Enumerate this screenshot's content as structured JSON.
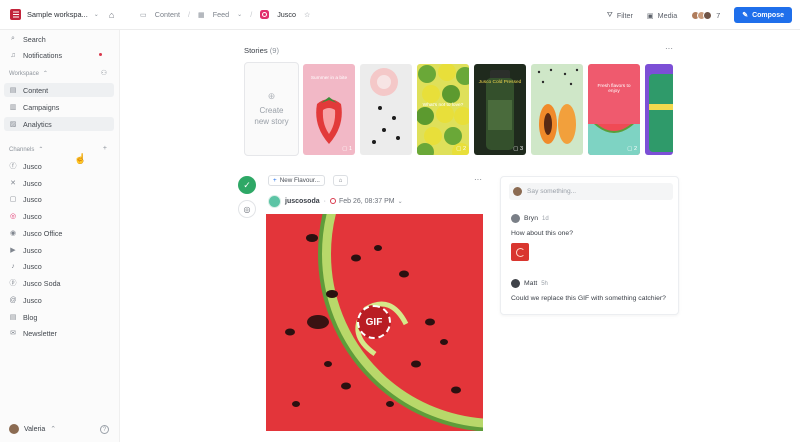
{
  "workspace": {
    "name": "Sample workspa...",
    "logo_color": "#c2243b"
  },
  "breadcrumbs": {
    "content": "Content",
    "feed": "Feed",
    "account": "Jusco"
  },
  "toolbar": {
    "filter": "Filter",
    "media": "Media",
    "collaborators_count": "7",
    "compose": "Compose",
    "accent": "#1f6feb"
  },
  "sidebar": {
    "search": "Search",
    "notifications": "Notifications",
    "workspace_heading": "Workspace",
    "workspace_items": [
      {
        "label": "Content",
        "icon": "content-icon"
      },
      {
        "label": "Campaigns",
        "icon": "campaigns-icon"
      },
      {
        "label": "Analytics",
        "icon": "analytics-icon"
      }
    ],
    "channels_heading": "Channels",
    "channels": [
      {
        "label": "Jusco",
        "icon": "facebook-icon"
      },
      {
        "label": "Jusco",
        "icon": "x-icon"
      },
      {
        "label": "Jusco",
        "icon": "linkedin-icon"
      },
      {
        "label": "Jusco",
        "icon": "instagram-icon"
      },
      {
        "label": "Jusco Office",
        "icon": "google-business-icon"
      },
      {
        "label": "Jusco",
        "icon": "youtube-icon"
      },
      {
        "label": "Jusco",
        "icon": "tiktok-icon"
      },
      {
        "label": "Jusco Soda",
        "icon": "pinterest-icon"
      },
      {
        "label": "Jusco",
        "icon": "threads-icon"
      },
      {
        "label": "Blog",
        "icon": "blog-icon"
      },
      {
        "label": "Newsletter",
        "icon": "newsletter-icon"
      }
    ],
    "user": "Valeria"
  },
  "stories": {
    "title": "Stories",
    "count": "(9)",
    "create_label_1": "Create",
    "create_label_2": "new story",
    "items": [
      {
        "comments": "1",
        "caption": "Summer in a bite"
      },
      {
        "comments": "",
        "caption": ""
      },
      {
        "comments": "2",
        "caption": "What's not to love?"
      },
      {
        "comments": "3",
        "caption": "Jusco Cold Pressed"
      },
      {
        "comments": "",
        "caption": ""
      },
      {
        "comments": "2",
        "caption": "Fresh flavors to enjoy"
      }
    ]
  },
  "post": {
    "tag": "New Flavour...",
    "username": "juscosoda",
    "date": "Feb 26, 08:37 PM",
    "gif_label": "GIF",
    "status_color": "#2ea866"
  },
  "comments": {
    "placeholder": "Say something...",
    "items": [
      {
        "author": "Bryn",
        "time": "1d",
        "text": "How about this one?"
      },
      {
        "author": "Matt",
        "time": "5h",
        "text": "Could we replace this GIF with something catchier?"
      }
    ]
  }
}
